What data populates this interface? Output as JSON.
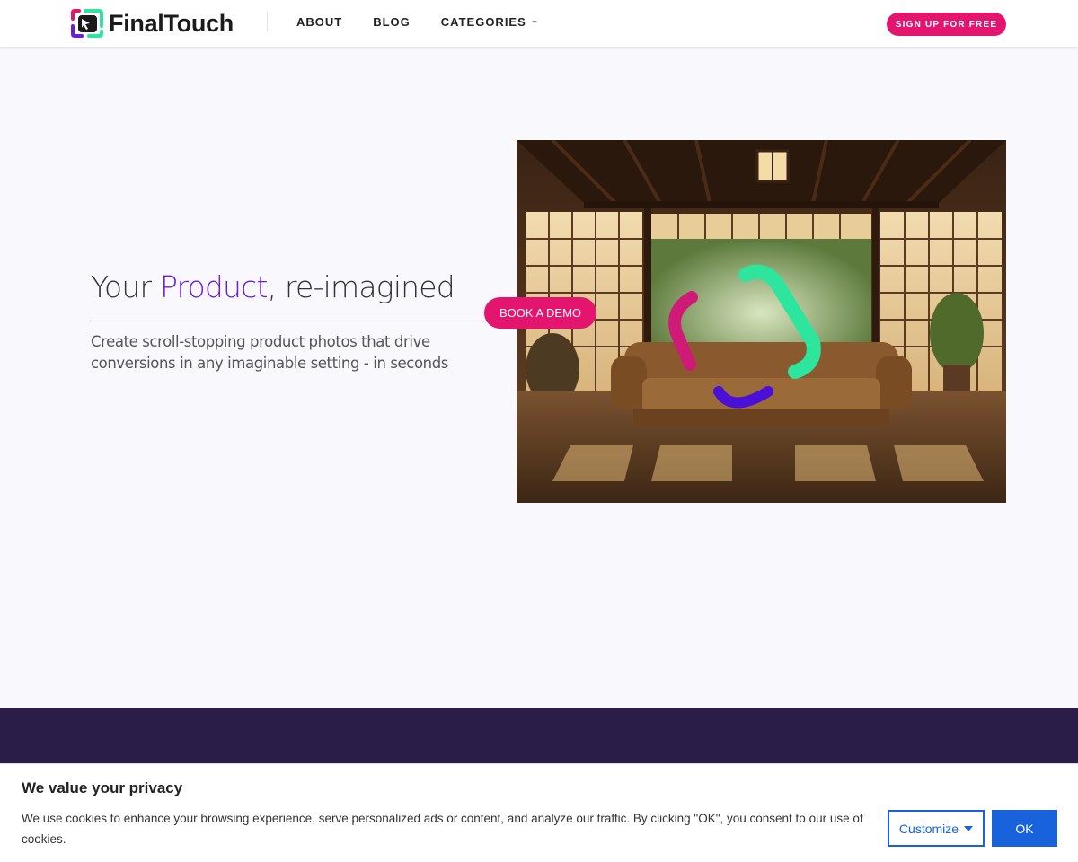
{
  "header": {
    "brand": "FinalTouch",
    "nav": [
      {
        "label": "ABOUT"
      },
      {
        "label": "BLOG"
      },
      {
        "label": "CATEGORIES"
      }
    ],
    "signup_label": "SIGN UP FOR FREE"
  },
  "hero": {
    "title_pre": "Your ",
    "title_accent": "Product",
    "title_post": ", re-imagined",
    "subtitle": "Create scroll-stopping product photos that drive conversions in any imaginable setting - in seconds",
    "demo_label": "BOOK A DEMO"
  },
  "cookie": {
    "title": "We value your privacy",
    "text": "We use cookies to enhance your browsing experience, serve personalized ads or content, and analyze our traffic. By clicking \"OK\", you consent to our use of cookies.",
    "customize_label": "Customize",
    "ok_label": "OK"
  },
  "colors": {
    "brand_pink": "#e3156f",
    "accent_purple": "#6a1ed8",
    "band": "#2a1e48",
    "cookie_blue": "#1863dc"
  }
}
